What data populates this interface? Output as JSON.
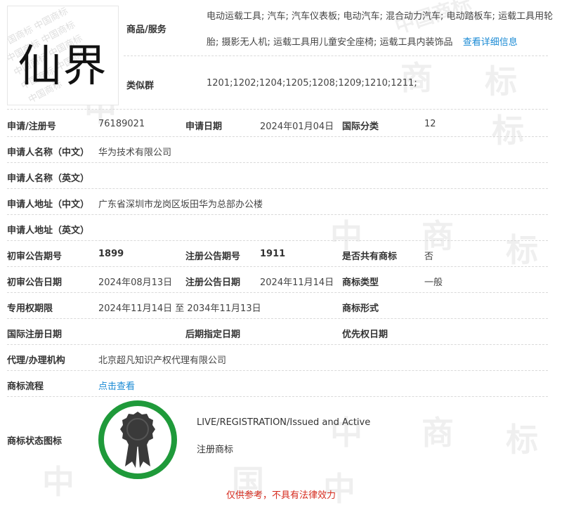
{
  "logo": {
    "text": "仙界"
  },
  "goods": {
    "label": "商品/服务",
    "line1": "电动运载工具; 汽车; 汽车仪表板; 电动汽车; 混合动力汽车; 电动踏板车; 运载工具用轮",
    "line2": "胎; 摄影无人机; 运载工具用儿童安全座椅; 运载工具内装饰品",
    "detail_link": "查看详细信息"
  },
  "similar": {
    "label": "类似群",
    "value": "1201;1202;1204;1205;1208;1209;1210;1211;"
  },
  "row_app": {
    "reg_label": "申请/注册号",
    "reg_value": "76189021",
    "date_label": "申请日期",
    "date_value": "2024年01月04日",
    "class_label": "国际分类",
    "class_value": "12"
  },
  "applicant_cn": {
    "label": "申请人名称（中文）",
    "value": "华为技术有限公司"
  },
  "applicant_en": {
    "label": "申请人名称（英文）",
    "value": ""
  },
  "address_cn": {
    "label": "申请人地址（中文）",
    "value": "广东省深圳市龙岗区坂田华为总部办公楼"
  },
  "address_en": {
    "label": "申请人地址（英文）",
    "value": ""
  },
  "row_pub": {
    "prelim_no_label": "初审公告期号",
    "prelim_no_value": "1899",
    "reg_no_label": "注册公告期号",
    "reg_no_value": "1911",
    "shared_label": "是否共有商标",
    "shared_value": "否"
  },
  "row_pub_date": {
    "prelim_date_label": "初审公告日期",
    "prelim_date_value": "2024年08月13日",
    "reg_date_label": "注册公告日期",
    "reg_date_value": "2024年11月14日",
    "type_label": "商标类型",
    "type_value": "一般"
  },
  "row_term": {
    "term_label": "专用权期限",
    "term_value": "2024年11月14日 至 2034年11月13日",
    "form_label": "商标形式",
    "form_value": ""
  },
  "row_intl": {
    "intl_label": "国际注册日期",
    "later_label": "后期指定日期",
    "priority_label": "优先权日期"
  },
  "agent": {
    "label": "代理/办理机构",
    "value": "北京超凡知识产权代理有限公司"
  },
  "process": {
    "label": "商标流程",
    "link": "点击查看"
  },
  "status": {
    "label": "商标状态图标",
    "en": "LIVE/REGISTRATION/Issued and Active",
    "cn": "注册商标",
    "ring_color": "#1f9a3a"
  },
  "watermark": {
    "char_zhong": "中",
    "char_guo": "国",
    "char_shang": "商",
    "char_biao": "标",
    "phrase": "中国商标"
  },
  "disclaimer": "仅供参考，不具有法律效力"
}
